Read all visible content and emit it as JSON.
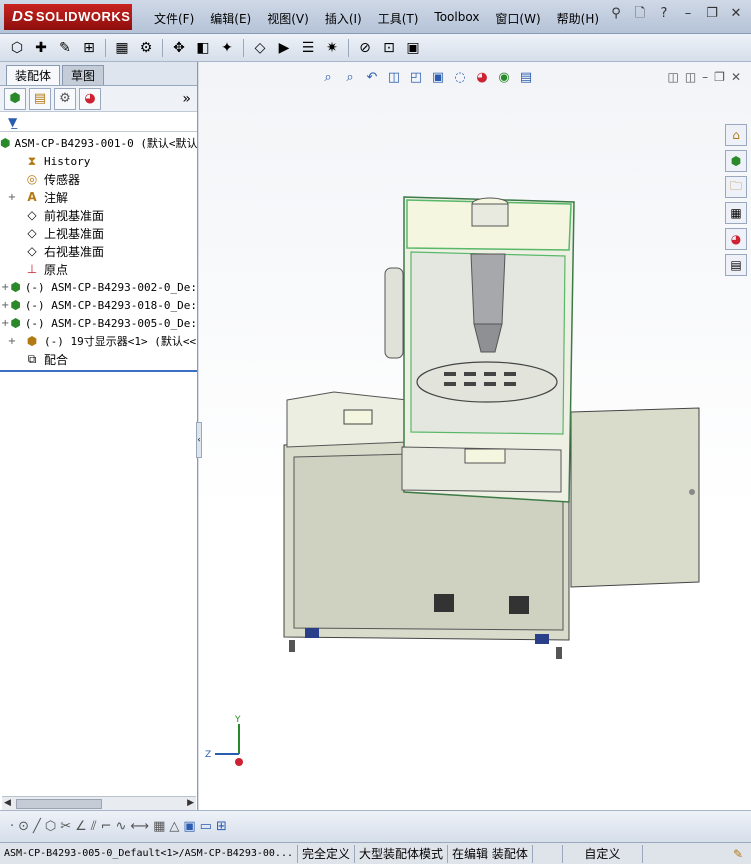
{
  "app": {
    "logo_prefix": "DS",
    "logo_text": "SOLIDWORKS"
  },
  "menu": [
    "文件(F)",
    "编辑(E)",
    "视图(V)",
    "插入(I)",
    "工具(T)",
    "Toolbox",
    "窗口(W)",
    "帮助(H)"
  ],
  "panel": {
    "tabs": [
      "装配体",
      "草图"
    ],
    "expand_label": "»"
  },
  "tree": [
    {
      "label": "ASM-CP-B4293-001-0  (默认<默认",
      "icon": "assembly-icon",
      "expand": ""
    },
    {
      "label": "History",
      "icon": "history-icon",
      "expand": ""
    },
    {
      "label": "传感器",
      "icon": "sensor-icon",
      "expand": ""
    },
    {
      "label": "注解",
      "icon": "annotation-icon",
      "expand": "+"
    },
    {
      "label": "前视基准面",
      "icon": "plane-icon",
      "expand": ""
    },
    {
      "label": "上视基准面",
      "icon": "plane-icon",
      "expand": ""
    },
    {
      "label": "右视基准面",
      "icon": "plane-icon",
      "expand": ""
    },
    {
      "label": "原点",
      "icon": "origin-icon",
      "expand": ""
    },
    {
      "label": "(-) ASM-CP-B4293-002-0_De:",
      "icon": "subassembly-icon",
      "expand": "+"
    },
    {
      "label": "(-) ASM-CP-B4293-018-0_De:",
      "icon": "subassembly-icon",
      "expand": "+"
    },
    {
      "label": "(-) ASM-CP-B4293-005-0_De:",
      "icon": "subassembly-icon",
      "expand": "+"
    },
    {
      "label": "(-) 19寸显示器<1> (默认<<",
      "icon": "subassembly-icon",
      "expand": "+"
    },
    {
      "label": "配合",
      "icon": "mates-icon",
      "expand": ""
    }
  ],
  "triad": {
    "y": "Y",
    "z": "Z"
  },
  "status": {
    "path": "ASM-CP-B4293-005-0_Default<1>/ASM-CP-B4293-00...",
    "definition": "完全定义",
    "mode": "大型装配体模式",
    "editing": "在编辑 装配体",
    "units": "自定义"
  },
  "colors": {
    "brand_red": "#c8231f",
    "cabinet": "#d9dccb",
    "frame_green": "#58b868",
    "panel_light": "#f4f6e0"
  }
}
